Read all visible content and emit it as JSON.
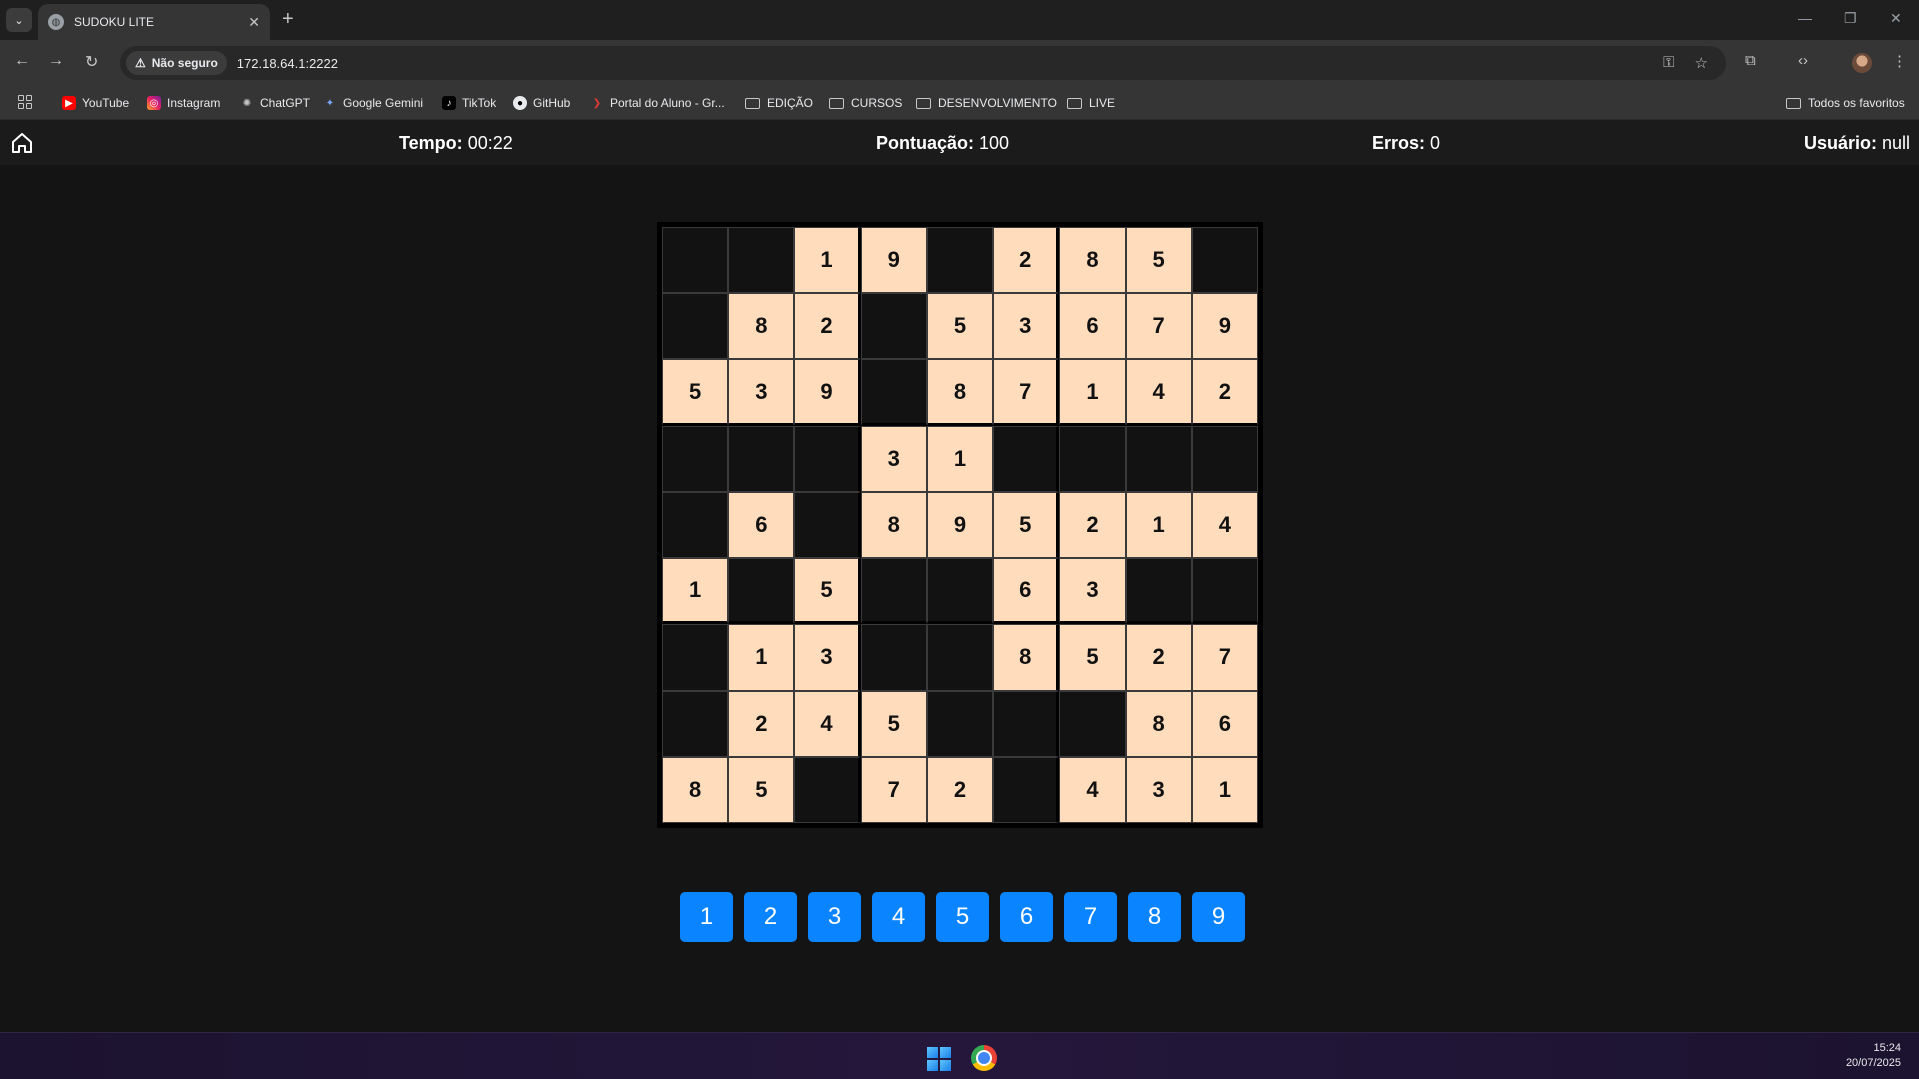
{
  "browser": {
    "tab_title": "SUDOKU LITE",
    "security_label": "Não seguro",
    "url": "172.18.64.1:2222",
    "bookmarks": [
      {
        "label": "YouTube",
        "icon": "youtube-icon"
      },
      {
        "label": "Instagram",
        "icon": "instagram-icon"
      },
      {
        "label": "ChatGPT",
        "icon": "chatgpt-icon"
      },
      {
        "label": "Google Gemini",
        "icon": "gemini-icon"
      },
      {
        "label": "TikTok",
        "icon": "tiktok-icon"
      },
      {
        "label": "GitHub",
        "icon": "github-icon"
      },
      {
        "label": "Portal do Aluno - Gr...",
        "icon": "portal-icon"
      },
      {
        "label": "EDIÇÃO",
        "icon": "folder-icon"
      },
      {
        "label": "CURSOS",
        "icon": "folder-icon"
      },
      {
        "label": "DESENVOLVIMENTO",
        "icon": "folder-icon"
      },
      {
        "label": "LIVE",
        "icon": "folder-icon"
      }
    ],
    "all_bookmarks": "Todos os favoritos"
  },
  "header": {
    "time_label": "Tempo:",
    "time_value": "00:22",
    "score_label": "Pontuação:",
    "score_value": "100",
    "errors_label": "Erros:",
    "errors_value": "0",
    "user_label": "Usuário:",
    "user_value": "null"
  },
  "board": [
    [
      "",
      "",
      "1",
      "9",
      "",
      "2",
      "8",
      "5",
      ""
    ],
    [
      "",
      "8",
      "2",
      "",
      "5",
      "3",
      "6",
      "7",
      "9"
    ],
    [
      "5",
      "3",
      "9",
      "",
      "8",
      "7",
      "1",
      "4",
      "2"
    ],
    [
      "",
      "",
      "",
      "3",
      "1",
      "",
      "",
      "",
      ""
    ],
    [
      "",
      "6",
      "",
      "8",
      "9",
      "5",
      "2",
      "1",
      "4"
    ],
    [
      "1",
      "",
      "5",
      "",
      "",
      "6",
      "3",
      "",
      ""
    ],
    [
      "",
      "1",
      "3",
      "",
      "",
      "8",
      "5",
      "2",
      "7"
    ],
    [
      "",
      "2",
      "4",
      "5",
      "",
      "",
      "",
      "8",
      "6"
    ],
    [
      "8",
      "5",
      "",
      "7",
      "2",
      "",
      "4",
      "3",
      "1"
    ]
  ],
  "numpad": [
    "1",
    "2",
    "3",
    "4",
    "5",
    "6",
    "7",
    "8",
    "9"
  ],
  "colors": {
    "filled_cell": "#ffdcbc",
    "empty_cell": "#121212",
    "numpad_button": "#0a84ff"
  },
  "taskbar": {
    "time": "15:24",
    "date": "20/07/2025"
  }
}
